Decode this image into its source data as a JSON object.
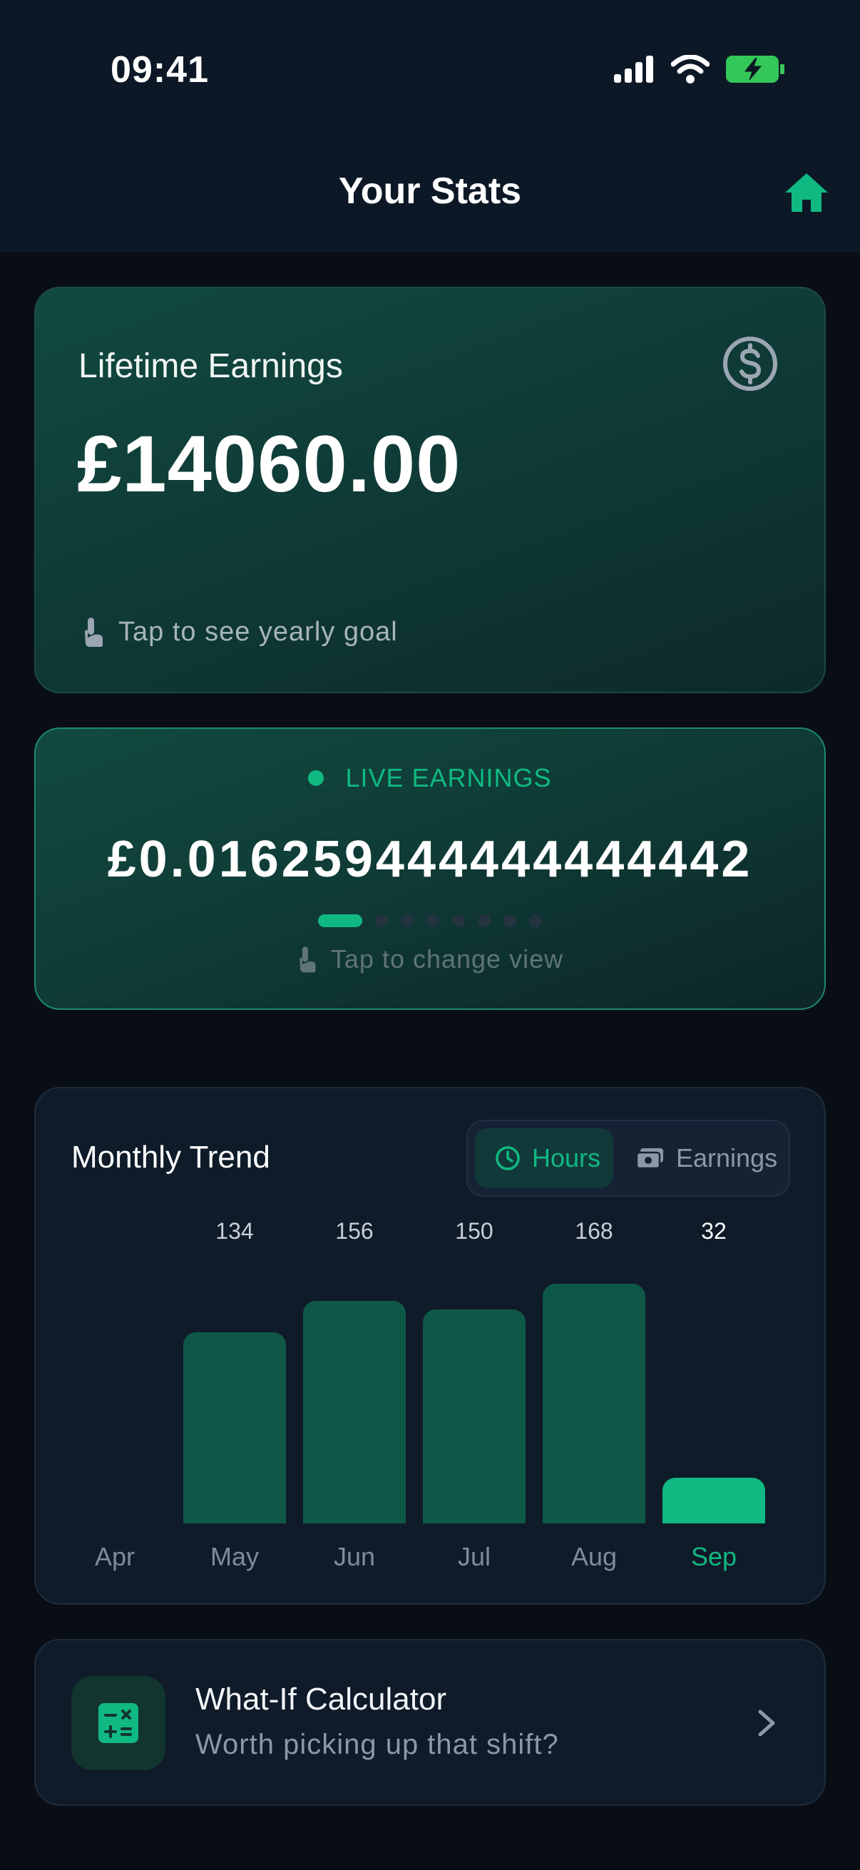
{
  "status_bar": {
    "time": "09:41"
  },
  "header": {
    "title": "Your Stats"
  },
  "lifetime": {
    "label": "Lifetime Earnings",
    "value": "£14060.00",
    "hint": "Tap to see yearly goal"
  },
  "live": {
    "label": "LIVE EARNINGS",
    "value": "£0.016259444444444442",
    "hint": "Tap to change view",
    "pager_total": 8,
    "pager_active": 0
  },
  "trend": {
    "title": "Monthly Trend",
    "toggle": {
      "hours_label": "Hours",
      "earnings_label": "Earnings",
      "selected": "Hours"
    }
  },
  "chart_data": {
    "type": "bar",
    "categories": [
      "Apr",
      "May",
      "Jun",
      "Jul",
      "Aug",
      "Sep"
    ],
    "values": [
      0,
      134,
      156,
      150,
      168,
      32
    ],
    "value_labels": [
      "",
      "134",
      "156",
      "150",
      "168",
      "32"
    ],
    "highlighted": "Sep",
    "title": "Monthly Trend",
    "ylim": [
      0,
      168
    ],
    "grid": false,
    "colors": {
      "bar": "#0f5848",
      "current": "#10b981"
    }
  },
  "calculator": {
    "title": "What-If Calculator",
    "subtitle": "Worth picking up that shift?"
  },
  "colors": {
    "accent": "#10b981",
    "background": "#080d16",
    "card": "#0f1b29"
  }
}
